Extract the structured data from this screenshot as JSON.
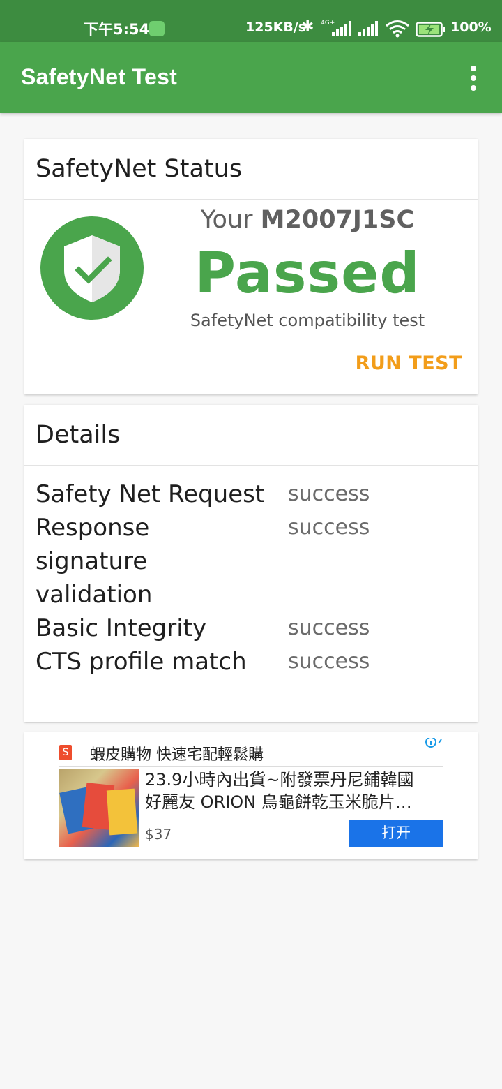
{
  "status_bar": {
    "time": "下午5:54",
    "network_speed": "125KB/s",
    "network_type": "4G+",
    "battery_percent": "100%",
    "icons": [
      "app-notification-icon",
      "bluetooth-icon",
      "cell-signal-icon",
      "cell-signal-icon",
      "wifi-icon",
      "battery-charging-icon"
    ]
  },
  "app_bar": {
    "title": "SafetyNet Test",
    "menu_icon": "overflow-menu-icon"
  },
  "status_card": {
    "header": "SafetyNet Status",
    "your_prefix": "Your",
    "device_model": "M2007J1SC",
    "result": "Passed",
    "subtitle": "SafetyNet compatibility test",
    "run_test_label": "RUN TEST",
    "shield_icon": "shield-check-icon",
    "accent_color": "#4aa54c",
    "action_color": "#f29d1a"
  },
  "details_card": {
    "header": "Details",
    "rows": [
      {
        "label": "Safety Net Request",
        "value": "success"
      },
      {
        "label": "Response signature validation",
        "value": "success"
      },
      {
        "label": "Basic Integrity",
        "value": "success"
      },
      {
        "label": "CTS profile match",
        "value": "success"
      }
    ]
  },
  "ad": {
    "logo_letter": "S",
    "brand": "蝦皮購物 快速宅配輕鬆購",
    "title": "23.9小時內出貨~附發票丹尼鋪韓國好麗友 ORION 烏龜餅乾玉米脆片…",
    "price": "$37",
    "open_label": "打开",
    "info_icon": "ad-info-icon"
  }
}
